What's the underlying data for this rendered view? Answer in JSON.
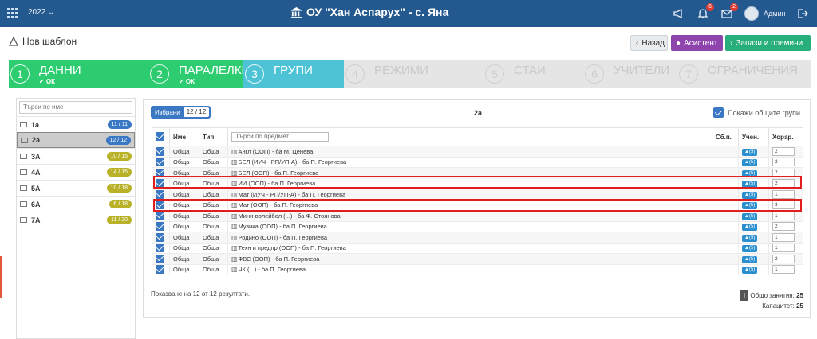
{
  "topbar": {
    "year": "2022",
    "school": "ОУ \"Хан Аспарух\" - с. Яна",
    "badge1": "6",
    "badge2": "2",
    "user": "Админ"
  },
  "page": {
    "title": "Нов шаблон",
    "back": "Назад",
    "assistant": "Асистент",
    "save": "Запази и премини"
  },
  "steps": [
    {
      "num": "1",
      "label": "ДАННИ",
      "sub": "✔ ОК"
    },
    {
      "num": "2",
      "label": "ПАРАЛЕЛКИ",
      "sub": "✔ ОК"
    },
    {
      "num": "3",
      "label": "ГРУПИ",
      "sub": ""
    },
    {
      "num": "4",
      "label": "РЕЖИМИ",
      "sub": ""
    },
    {
      "num": "5",
      "label": "СТАИ",
      "sub": ""
    },
    {
      "num": "6",
      "label": "УЧИТЕЛИ",
      "sub": ""
    },
    {
      "num": "7",
      "label": "ОГРАНИЧЕНИЯ",
      "sub": ""
    }
  ],
  "left": {
    "search_placeholder": "Търси по име",
    "classes": [
      {
        "name": "1а",
        "count": "11 / 11"
      },
      {
        "name": "2а",
        "count": "12 / 12"
      },
      {
        "name": "3А",
        "count": "10 / 15"
      },
      {
        "name": "4А",
        "count": "14 / 15"
      },
      {
        "name": "5А",
        "count": "10 / 18"
      },
      {
        "name": "6А",
        "count": "6 / 18"
      },
      {
        "name": "7А",
        "count": "11 / 20"
      }
    ]
  },
  "card": {
    "selected_label": "Избрани",
    "selected_count": "12 / 12",
    "class_title": "2а",
    "show_all": "Покажи общите групи",
    "headers": {
      "name": "Име",
      "type": "Тип",
      "filter_placeholder": "Търси по предмет",
      "sb": "Сб.п.",
      "students": "Учен.",
      "hours": "Хорар."
    },
    "rows": [
      {
        "name": "Обща",
        "type": "Обща",
        "subject": "Англ (ООП) - ба М. Ценева",
        "st": "(5)",
        "h": "2"
      },
      {
        "name": "Обща",
        "type": "Обща",
        "subject": "БЕЛ (ИУЧ - РП/УП-А) - ба П. Георгиева",
        "st": "(5)",
        "h": "2"
      },
      {
        "name": "Обща",
        "type": "Обща",
        "subject": "БЕЛ (ООП) - ба П. Георгиева",
        "st": "(5)",
        "h": "7"
      },
      {
        "name": "Обща",
        "type": "Обща",
        "subject": "ИИ (ООП) - ба П. Георгиева",
        "st": "(5)",
        "h": "2"
      },
      {
        "name": "Обща",
        "type": "Обща",
        "subject": "Мат (ИУЧ - РП/УП-А) - ба П. Георгиева",
        "st": "(5)",
        "h": "1"
      },
      {
        "name": "Обща",
        "type": "Обща",
        "subject": "Мат (ООП) - ба П. Георгиева",
        "st": "(5)",
        "h": "3"
      },
      {
        "name": "Обща",
        "type": "Обща",
        "subject": "Мини-волейбол (...) - ба Ф. Стоянова",
        "st": "(5)",
        "h": "1"
      },
      {
        "name": "Обща",
        "type": "Обща",
        "subject": "Музика (ООП) - ба П. Георгиева",
        "st": "(5)",
        "h": "2"
      },
      {
        "name": "Обща",
        "type": "Обща",
        "subject": "Родино (ООП) - ба П. Георгиева",
        "st": "(5)",
        "h": "1"
      },
      {
        "name": "Обща",
        "type": "Обща",
        "subject": "Техн и предпр (ООП) - ба П. Георгиева",
        "st": "(5)",
        "h": "1"
      },
      {
        "name": "Обща",
        "type": "Обща",
        "subject": "ФВС (ООП) - ба П. Георгиева",
        "st": "(5)",
        "h": "2"
      },
      {
        "name": "Обща",
        "type": "Обща",
        "subject": "ЧК (...) - ба П. Георгиева",
        "st": "(5)",
        "h": "1"
      }
    ],
    "results": "Показване на 12 от 12 резултати.",
    "total_label": "Общо занятия:",
    "total": "25",
    "capacity_label": "Капацитет:",
    "capacity": "25"
  },
  "colors": {
    "topbar": "#24598f",
    "step_done": "#2ecc71",
    "step_active": "#4fc3d6",
    "highlight": "#e01e1e"
  }
}
